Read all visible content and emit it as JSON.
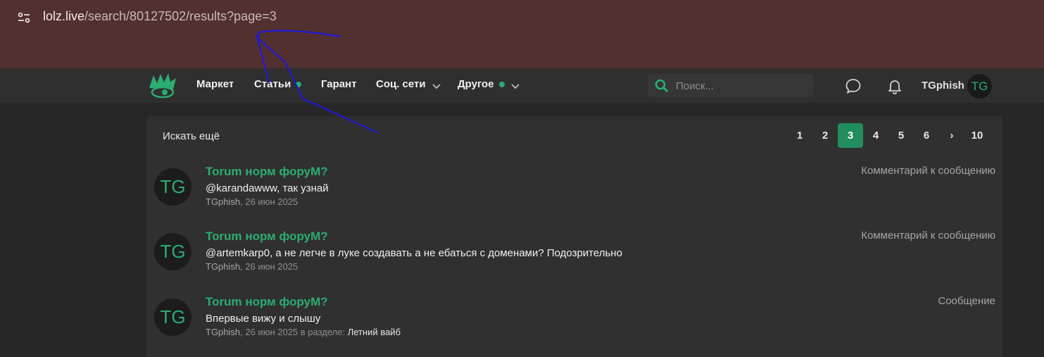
{
  "browser": {
    "url_host": "lolz.live",
    "url_path": "/search/80127502/results?page=3"
  },
  "nav": {
    "items": [
      {
        "label": "Маркет",
        "dot": false,
        "chevron": false
      },
      {
        "label": "Статьи",
        "dot": true,
        "chevron": false
      },
      {
        "label": "Гарант",
        "dot": false,
        "chevron": false
      },
      {
        "label": "Соц. сети",
        "dot": false,
        "chevron": true
      },
      {
        "label": "Другое",
        "dot": true,
        "chevron": true
      }
    ],
    "search_placeholder": "Поиск...",
    "username": "TGphish",
    "avatar_initials": "TG"
  },
  "results_header": {
    "search_more": "Искать ещё",
    "pages": [
      "1",
      "2",
      "3",
      "4",
      "5",
      "6",
      "›",
      "10"
    ],
    "current_page": "3"
  },
  "results": [
    {
      "avatar": "TG",
      "title": "Torum норм форуМ?",
      "text": "@karandawww, так узнай",
      "author": "TGphish",
      "date": ", 26 июн 2025",
      "section_prefix": "",
      "section": "",
      "type": "Комментарий к сообщению"
    },
    {
      "avatar": "TG",
      "title": "Torum норм форуМ?",
      "text": "@artemkarp0, а не легче в луке создавать а не ебаться с доменами? Подозрительно",
      "author": "TGphish",
      "date": ", 26 июн 2025",
      "section_prefix": "",
      "section": "",
      "type": "Комментарий к сообщению"
    },
    {
      "avatar": "TG",
      "title": "Torum норм форуМ?",
      "text": "Впервые вижу и слышу",
      "author": "TGphish",
      "date": ", 26 июн 2025",
      "section_prefix": " в разделе: ",
      "section": "Летний вайб",
      "type": "Сообщение"
    }
  ],
  "colors": {
    "accent_green": "#2bad72",
    "annotation_blue": "#1f18d6"
  }
}
